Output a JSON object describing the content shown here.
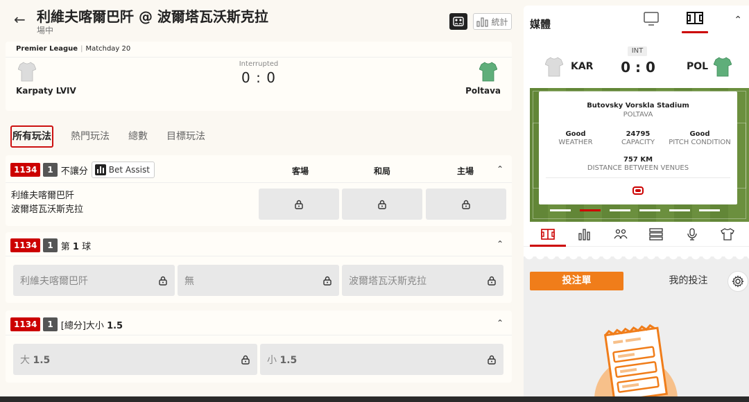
{
  "header": {
    "title": "利維夫喀爾巴阡 @ 波爾塔瓦沃斯克拉",
    "subtitle": "場中",
    "stats_label": "統計"
  },
  "scoreboard": {
    "league": "Premier League",
    "matchday": "Matchday 20",
    "status": "Interrupted",
    "score": "0 : 0",
    "home_team": "Karpaty LVIV",
    "away_team": "Poltava",
    "home_jersey_color": "#dddddd",
    "away_jersey_color": "#5fae7a"
  },
  "tabs": [
    {
      "label": "所有玩法",
      "active": true
    },
    {
      "label": "熱門玩法",
      "active": false
    },
    {
      "label": "總數",
      "active": false
    },
    {
      "label": "目標玩法",
      "active": false
    }
  ],
  "markets": [
    {
      "code": "1134",
      "num": "1",
      "title": "不讓分",
      "bet_assist": "Bet Assist",
      "columns": [
        "客場",
        "和局",
        "主場"
      ],
      "row_team_1": "利維夫喀爾巴阡",
      "row_team_2": "波爾塔瓦沃斯克拉"
    },
    {
      "code": "1134",
      "num": "1",
      "title_prefix": "第",
      "title_bold": "1",
      "title_suffix": "球",
      "options": [
        "利維夫喀爾巴阡",
        "無",
        "波爾塔瓦沃斯克拉"
      ]
    },
    {
      "code": "1134",
      "num": "1",
      "title_prefix": "[總分]大小",
      "title_bold": "1.5",
      "options": [
        {
          "prefix": "大",
          "value": "1.5"
        },
        {
          "prefix": "小",
          "value": "1.5"
        }
      ]
    }
  ],
  "media": {
    "title": "媒體",
    "mini_status": "INT",
    "mini_score": "0 : 0",
    "home_abbr": "KAR",
    "away_abbr": "POL",
    "venue": "Butovsky Vorskla Stadium",
    "city": "POLTAVA",
    "weather_value": "Good",
    "weather_label": "WEATHER",
    "capacity_value": "24795",
    "capacity_label": "CAPACITY",
    "pitch_value": "Good",
    "pitch_label": "PITCH CONDITION",
    "distance_value": "757 KM",
    "distance_label": "DISTANCE BETWEEN VENUES",
    "active_page": 1,
    "page_count": 6
  },
  "betslip": {
    "main_label": "投注單",
    "my_bets_label": "我的投注"
  },
  "colors": {
    "accent_red": "#cc0000",
    "accent_orange": "#f07d1a",
    "pitch_green": "#6b8f3e"
  }
}
